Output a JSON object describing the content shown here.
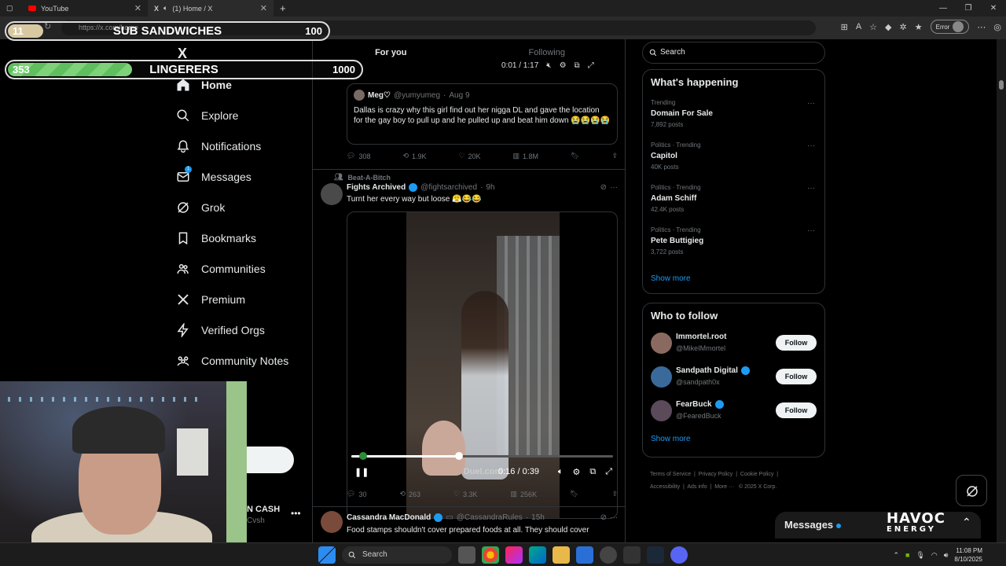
{
  "browser": {
    "tabs": [
      {
        "title": "YouTube",
        "active": false
      },
      {
        "title": "(1) Home / X",
        "active": true
      }
    ],
    "url": "https://x.com/home",
    "error_label": "Error"
  },
  "overlays": {
    "bar1": {
      "count": "11",
      "label": "SUB SANDWICHES",
      "max": "100",
      "progress": 0.11
    },
    "bar2": {
      "count": "353",
      "label": "LINGERERS",
      "max": "1000",
      "progress": 0.353
    }
  },
  "nav": {
    "items": [
      {
        "label": "Home",
        "icon": "home-icon"
      },
      {
        "label": "Explore",
        "icon": "search-icon"
      },
      {
        "label": "Notifications",
        "icon": "bell-icon"
      },
      {
        "label": "Messages",
        "icon": "mail-icon",
        "badge": "1"
      },
      {
        "label": "Grok",
        "icon": "grok-icon"
      },
      {
        "label": "Bookmarks",
        "icon": "bookmark-icon"
      },
      {
        "label": "Communities",
        "icon": "people-icon"
      },
      {
        "label": "Premium",
        "icon": "x-logo-icon"
      },
      {
        "label": "Verified Orgs",
        "icon": "lightning-icon"
      },
      {
        "label": "Community Notes",
        "icon": "notes-icon"
      }
    ],
    "account": {
      "name": "N CASH",
      "handle": "Cvsh"
    }
  },
  "timeline": {
    "tabs": [
      "For you",
      "Following"
    ],
    "mini_player_time": "0:01 / 1:17",
    "quoted_post": {
      "name": "Meg♡",
      "handle": "@yumyumeg",
      "date": "Aug 9",
      "text": "Dallas is crazy why this girl find out her nigga DL and gave the location for the gay boy to pull up and he pulled up and beat him down 😭😭😭😭"
    },
    "post1_actions": {
      "replies": "308",
      "reposts": "1.9K",
      "likes": "20K",
      "views": "1.8M"
    },
    "post2": {
      "context": "Beat-A-Bitch",
      "name": "Fights Archived",
      "handle": "@fightsarchived",
      "time": "9h",
      "text": "Turnt her every way but loose 😤😂😂",
      "video_time": "0:16 / 0:39",
      "video_progress": 0.41,
      "watermark": "Duel.com"
    },
    "post2_actions": {
      "replies": "30",
      "reposts": "263",
      "likes": "3.3K",
      "views": "256K"
    },
    "post3": {
      "name": "Cassandra MacDonald",
      "handle": "@CassandraRules",
      "time": "15h",
      "text": "Food stamps shouldn't cover prepared foods at all. They should cover"
    }
  },
  "right": {
    "search_placeholder": "Search",
    "whats_happening": {
      "title": "What's happening",
      "trends": [
        {
          "meta": "Trending",
          "name": "Domain For Sale",
          "count": "7,892 posts"
        },
        {
          "meta": "Politics · Trending",
          "name": "Capitol",
          "count": "40K posts"
        },
        {
          "meta": "Politics · Trending",
          "name": "Adam Schiff",
          "count": "42.4K posts"
        },
        {
          "meta": "Politics · Trending",
          "name": "Pete Buttigieg",
          "count": "3,722 posts"
        }
      ],
      "show_more": "Show more"
    },
    "who_to_follow": {
      "title": "Who to follow",
      "accounts": [
        {
          "name": "Immortel.root",
          "handle": "@MikeIMmortel",
          "verified": false,
          "color": "#8a6a60"
        },
        {
          "name": "Sandpath Digital",
          "handle": "@sandpath0x",
          "verified": true,
          "color": "#3a6a9a"
        },
        {
          "name": "FearBuck",
          "handle": "@FearedBuck",
          "verified": true,
          "color": "#5a4a5a"
        }
      ],
      "follow_label": "Follow",
      "show_more": "Show more"
    },
    "footer": [
      "Terms of Service",
      "Privacy Policy",
      "Cookie Policy",
      "Accessibility",
      "Ads info",
      "More ···",
      "© 2025 X Corp."
    ],
    "messages_label": "Messages",
    "havoc": {
      "line1": "HAVOC",
      "line2": "ENERGY"
    }
  },
  "taskbar": {
    "search_label": "Search",
    "time": "11:08 PM",
    "date": "8/10/2025"
  }
}
